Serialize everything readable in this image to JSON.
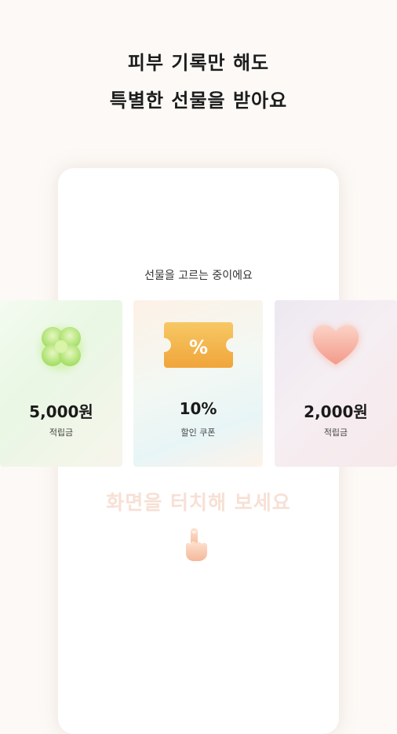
{
  "headline": {
    "line1": "피부 기록만 해도",
    "line2": "특별한 선물을 받아요"
  },
  "phone": {
    "status_text": "선물을 고르는 중이에요",
    "tap_prompt": "화면을 터치해 보세요"
  },
  "cards": [
    {
      "icon": "clover-icon",
      "amount": "5,000원",
      "kind": "적립금"
    },
    {
      "icon": "coupon-ticket-icon",
      "amount": "10%",
      "kind": "할인 쿠폰",
      "icon_symbol": "%"
    },
    {
      "icon": "heart-icon",
      "amount": "2,000원",
      "kind": "적립금"
    }
  ],
  "colors": {
    "background": "#fcf9f6",
    "clover": "#b8e67a",
    "coupon": "#f2b44a",
    "heart": "#f6b5a6",
    "tap_prompt": "#f7e0d5"
  }
}
